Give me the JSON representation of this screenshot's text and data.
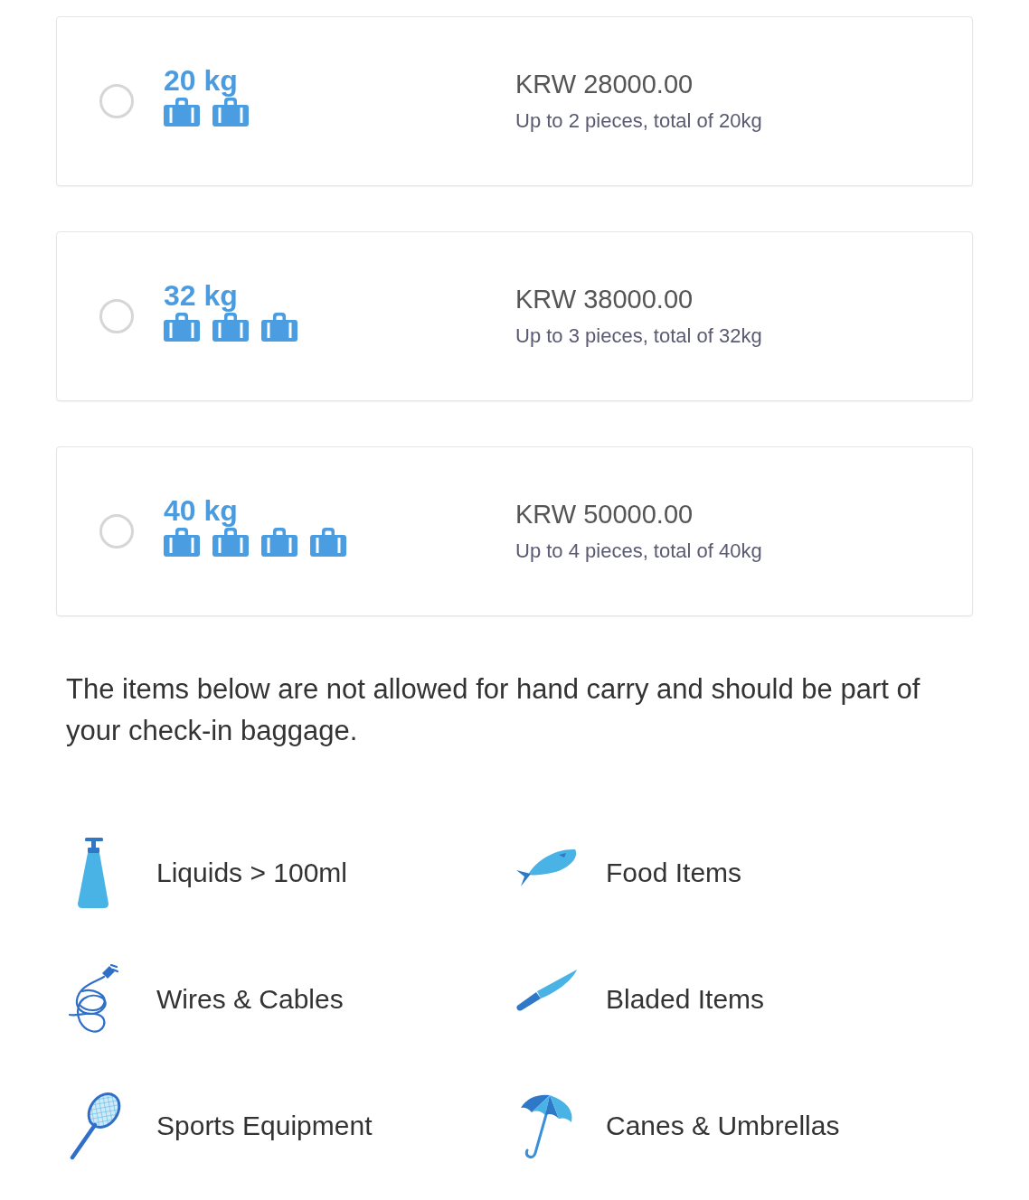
{
  "baggage_options": [
    {
      "weight": "20 kg",
      "selected": false,
      "bags": [
        {
          "kind": "suitcase"
        },
        {
          "kind": "suitcase"
        }
      ],
      "price": "KRW 28000.00",
      "description": "Up to 2 pieces, total of 20kg"
    },
    {
      "weight": "32 kg",
      "selected": false,
      "bags": [
        {
          "kind": "suitcase"
        },
        {
          "kind": "suitcase"
        },
        {
          "kind": "suitcase"
        }
      ],
      "price": "KRW 38000.00",
      "description": "Up to 3 pieces, total of 32kg"
    },
    {
      "weight": "40 kg",
      "selected": false,
      "bags": [
        {
          "kind": "suitcase"
        },
        {
          "kind": "suitcase"
        },
        {
          "kind": "suitcase"
        },
        {
          "kind": "suitcase"
        }
      ],
      "price": "KRW 50000.00",
      "description": "Up to 4 pieces, total of 40kg"
    }
  ],
  "notice": "The items below are not allowed for hand carry and should be part of your check-in baggage.",
  "restricted_items": [
    {
      "kind": "bottle",
      "label": "Liquids > 100ml"
    },
    {
      "kind": "fish",
      "label": "Food Items"
    },
    {
      "kind": "cable",
      "label": "Wires & Cables"
    },
    {
      "kind": "knife",
      "label": "Bladed Items"
    },
    {
      "kind": "racket",
      "label": "Sports Equipment"
    },
    {
      "kind": "umbrella",
      "label": "Canes & Umbrellas"
    }
  ]
}
